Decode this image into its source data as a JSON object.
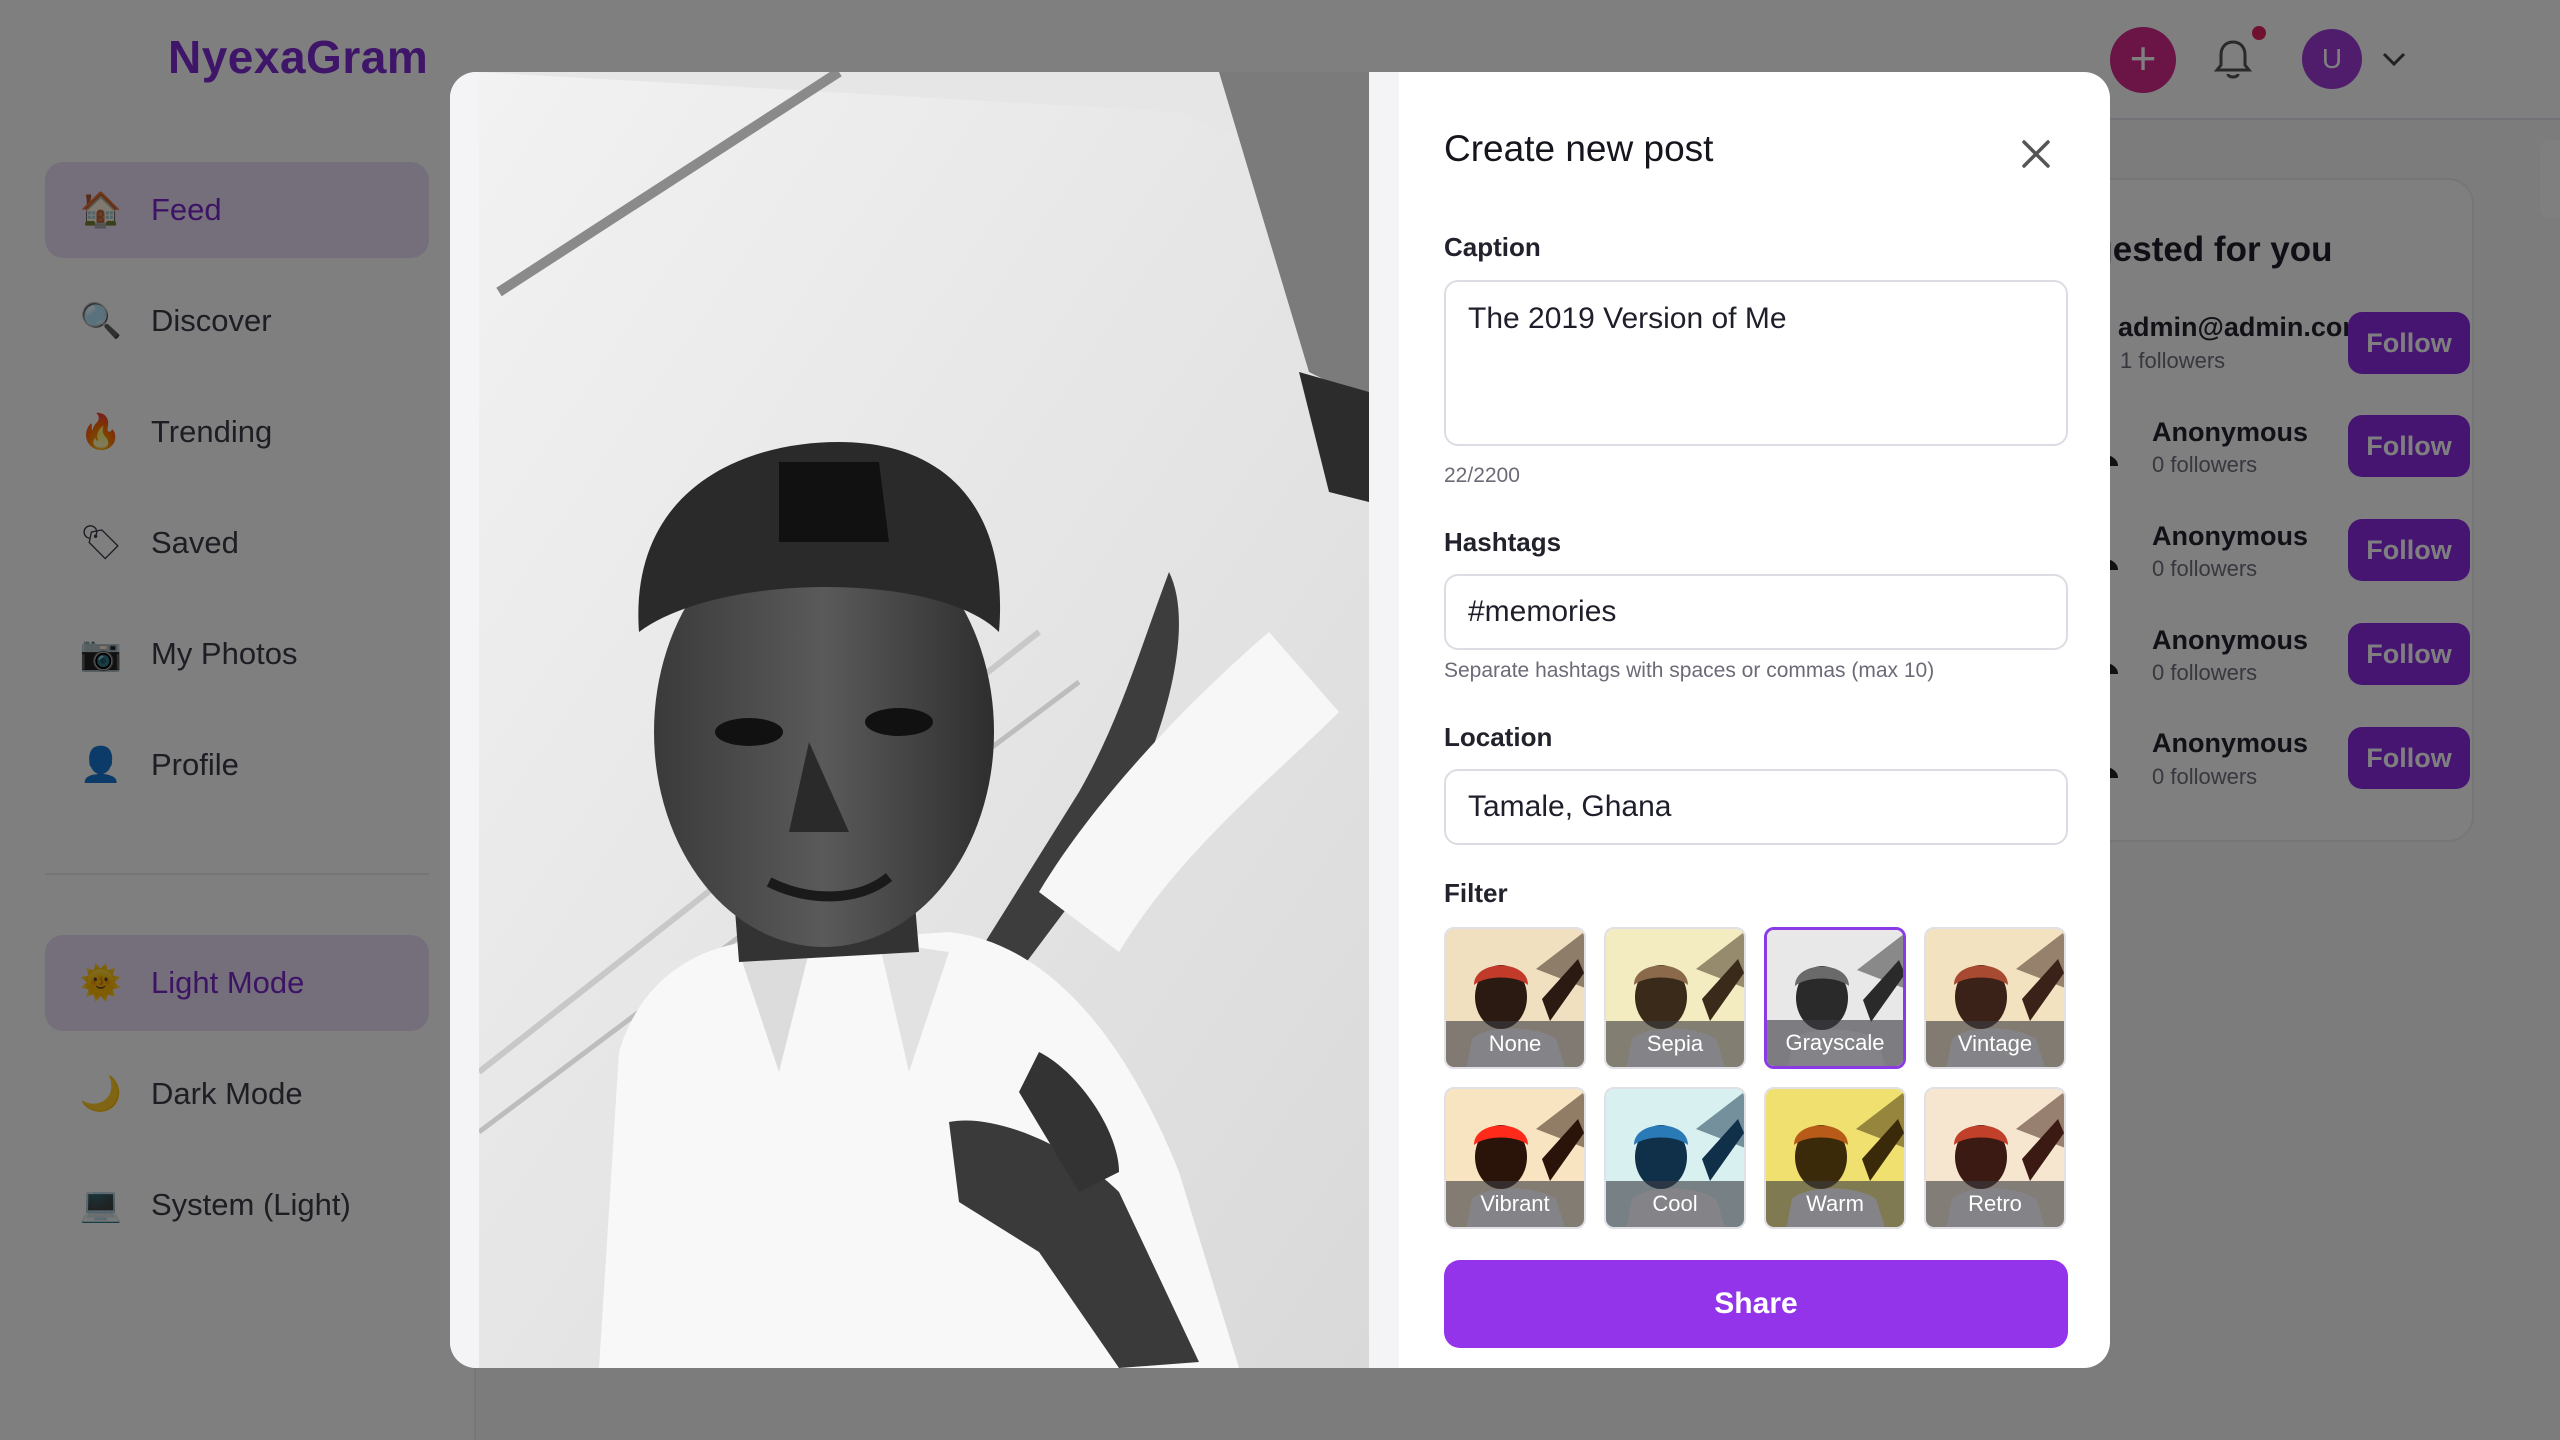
{
  "app": {
    "brand": "NyexaGram"
  },
  "header": {
    "user_initial": "U",
    "colors": {
      "brand": "#7d2bd0",
      "create_button": "#d6288c",
      "avatar": "#a03bd8",
      "notification_dot": "#e0245e"
    }
  },
  "sidebar": {
    "items": [
      {
        "label": "Feed",
        "icon": "house-icon",
        "active": true
      },
      {
        "label": "Discover",
        "icon": "magnifier-icon",
        "active": false
      },
      {
        "label": "Trending",
        "icon": "fire-icon",
        "active": false
      },
      {
        "label": "Saved",
        "icon": "tag-icon",
        "active": false
      },
      {
        "label": "My Photos",
        "icon": "camera-icon",
        "active": false
      },
      {
        "label": "Profile",
        "icon": "person-icon",
        "active": false
      }
    ],
    "themes": [
      {
        "label": "Light Mode",
        "icon": "sun-icon",
        "active": true
      },
      {
        "label": "Dark Mode",
        "icon": "moon-icon",
        "active": false
      },
      {
        "label": "System (Light)",
        "icon": "laptop-icon",
        "active": false
      }
    ]
  },
  "suggestions": {
    "title": "ggested for you",
    "follow_label": "Follow",
    "users": [
      {
        "name": "admin@admin.com",
        "followers": "1 followers"
      },
      {
        "name": "Anonymous",
        "followers": "0 followers"
      },
      {
        "name": "Anonymous",
        "followers": "0 followers"
      },
      {
        "name": "Anonymous",
        "followers": "0 followers"
      },
      {
        "name": "Anonymous",
        "followers": "0 followers"
      }
    ]
  },
  "modal": {
    "title": "Create new post",
    "caption": {
      "label": "Caption",
      "value": "The 2019 Version of Me",
      "counter": "22/2200"
    },
    "hashtags": {
      "label": "Hashtags",
      "value": "#memories",
      "helper": "Separate hashtags with spaces or commas (max 10)"
    },
    "location": {
      "label": "Location",
      "value": "Tamale, Ghana"
    },
    "filter": {
      "label": "Filter",
      "selected": "Grayscale",
      "options": [
        "None",
        "Sepia",
        "Grayscale",
        "Vintage",
        "Vibrant",
        "Cool",
        "Warm",
        "Retro"
      ]
    },
    "share_label": "Share",
    "accent": "#9333ea"
  }
}
